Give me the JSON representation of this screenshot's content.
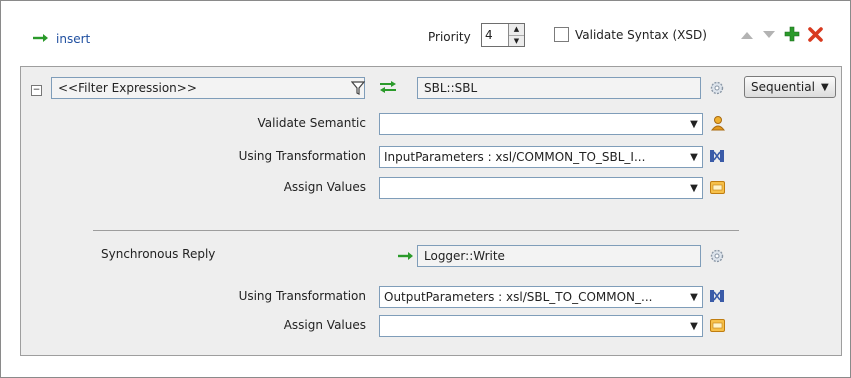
{
  "toolbar": {
    "insert_label": "insert",
    "priority_label": "Priority",
    "priority_value": "4",
    "validate_syntax_label": "Validate Syntax (XSD)",
    "validate_syntax_checked": false
  },
  "route": {
    "filter_expression": "<<Filter Expression>>",
    "target_service": "SBL::SBL",
    "execution_mode": "Sequential",
    "validate_semantic_label": "Validate Semantic",
    "validate_semantic_value": "",
    "using_transformation_label": "Using Transformation",
    "using_transformation_value": "InputParameters : xsl/COMMON_TO_SBL_I...",
    "assign_values_label": "Assign Values",
    "assign_values_value": ""
  },
  "reply": {
    "label": "Synchronous Reply",
    "target_service": "Logger::Write",
    "using_transformation_label": "Using Transformation",
    "using_transformation_value": "OutputParameters : xsl/SBL_TO_COMMON_...",
    "assign_values_label": "Assign Values",
    "assign_values_value": ""
  },
  "colors": {
    "accent_green": "#2a9a2a",
    "delete_red": "#d83a1f",
    "link_blue": "#1f4fa0"
  }
}
